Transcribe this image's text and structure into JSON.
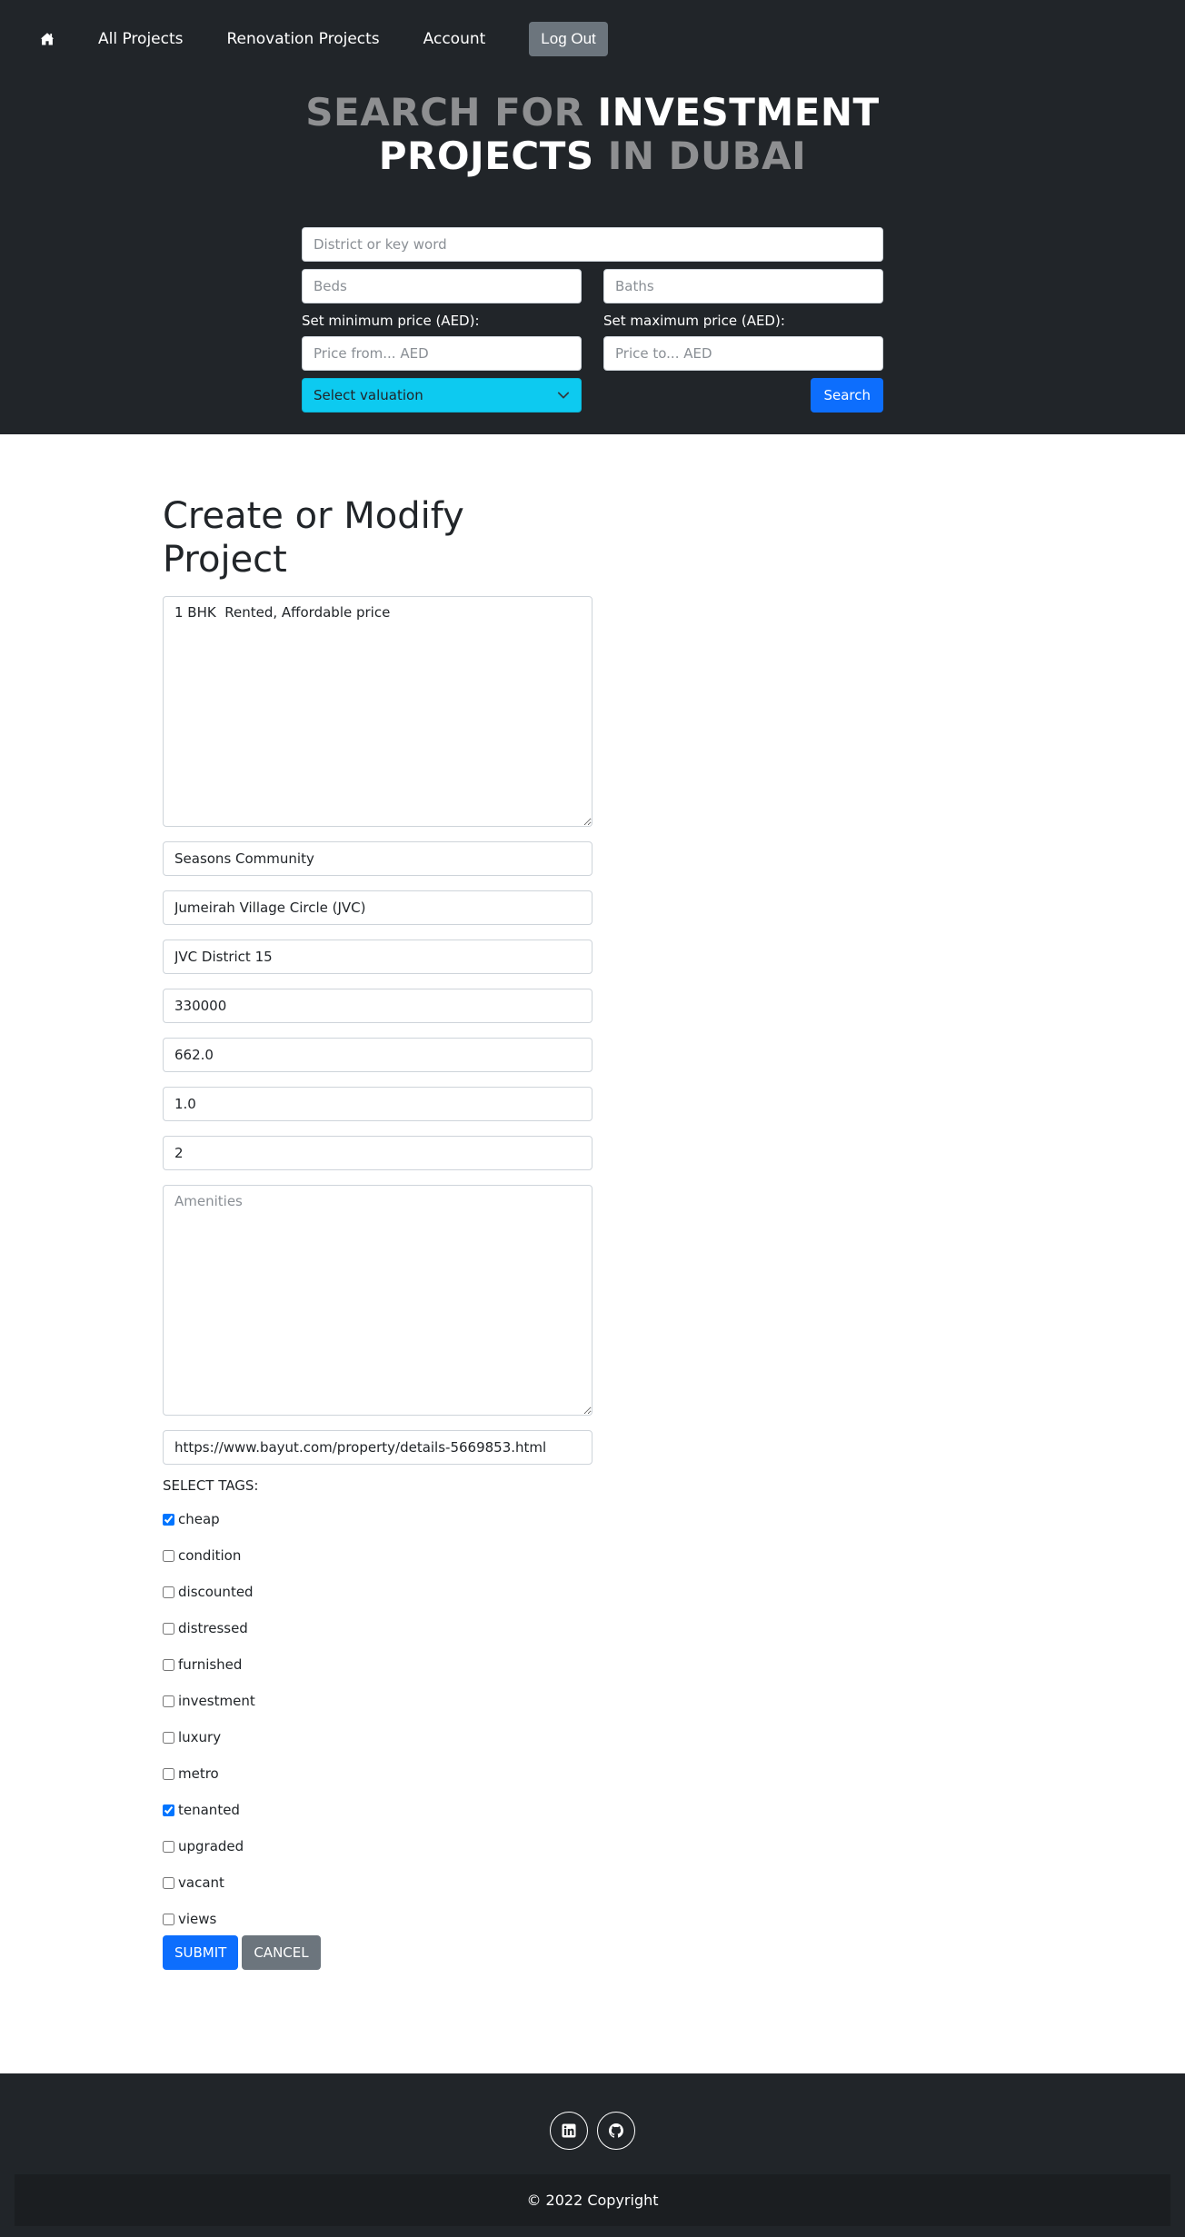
{
  "nav": {
    "home_icon": "house-icon",
    "all_projects": "All Projects",
    "renovation_projects": "Renovation Projects",
    "account": "Account",
    "logout": "Log Out"
  },
  "hero": {
    "part1": "SEARCH FOR ",
    "part2": "INVESTMENT",
    "part3": "PROJECTS",
    "part4": " IN DUBAI"
  },
  "search": {
    "district_placeholder": "District or key word",
    "beds_placeholder": "Beds",
    "baths_placeholder": "Baths",
    "min_price_label": "Set minimum price (AED):",
    "max_price_label": "Set maximum price (AED):",
    "price_from_placeholder": "Price from... AED",
    "price_to_placeholder": "Price to... AED",
    "valuation_selected": "Select valuation",
    "search_button": "Search"
  },
  "form": {
    "title": "Create or Modify Project",
    "description": "1 BHK  Rented, Affordable price",
    "project_name": "Seasons Community",
    "community": "Jumeirah Village Circle (JVC)",
    "district": "JVC District 15",
    "price": "330000",
    "area": "662.0",
    "baths": "1.0",
    "beds": "2",
    "amenities_placeholder": "Amenities",
    "url": "https://www.bayut.com/property/details-5669853.html",
    "tags_label": "SELECT TAGS:",
    "tags": [
      {
        "label": "cheap",
        "checked": true
      },
      {
        "label": "condition",
        "checked": false
      },
      {
        "label": "discounted",
        "checked": false
      },
      {
        "label": "distressed",
        "checked": false
      },
      {
        "label": "furnished",
        "checked": false
      },
      {
        "label": "investment",
        "checked": false
      },
      {
        "label": "luxury",
        "checked": false
      },
      {
        "label": "metro",
        "checked": false
      },
      {
        "label": "tenanted",
        "checked": true
      },
      {
        "label": "upgraded",
        "checked": false
      },
      {
        "label": "vacant",
        "checked": false
      },
      {
        "label": "views",
        "checked": false
      }
    ],
    "submit": "SUBMIT",
    "cancel": "CANCEL"
  },
  "footer": {
    "social_icons": [
      "linkedin-icon",
      "github-icon"
    ],
    "copyright": "© 2022 Copyright"
  },
  "colors": {
    "dark": "#212529",
    "primary": "#0d6efd",
    "secondary": "#6c757d",
    "info": "#0dcaf0",
    "hero_dim": "#8e8f91"
  }
}
